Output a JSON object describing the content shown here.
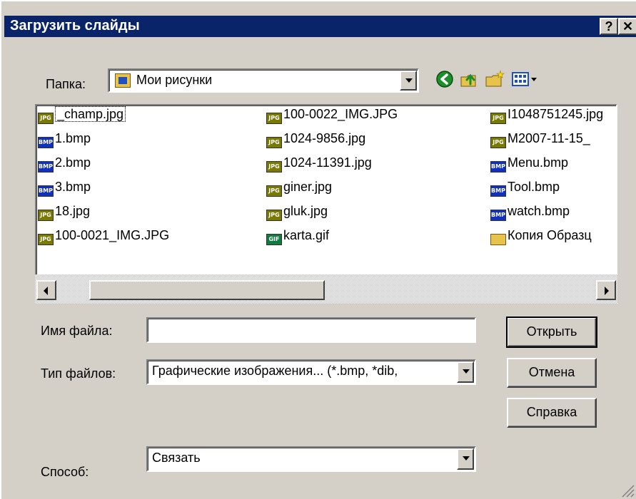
{
  "window": {
    "title": "Загрузить слайды",
    "help_label": "?",
    "close_label": "✕"
  },
  "folder": {
    "label": "Папка:",
    "value": "Мои рисунки"
  },
  "toolbar": {
    "back_icon": "back-icon",
    "up_icon": "up-folder-icon",
    "new_folder_icon": "new-folder-icon",
    "view_icon": "view-menu-icon"
  },
  "files": {
    "col1": [
      {
        "name": "_champ.jpg",
        "type": "JPG"
      },
      {
        "name": "1.bmp",
        "type": "BMP"
      },
      {
        "name": "2.bmp",
        "type": "BMP"
      },
      {
        "name": "3.bmp",
        "type": "BMP"
      },
      {
        "name": "18.jpg",
        "type": "JPG"
      },
      {
        "name": "100-0021_IMG.JPG",
        "type": "JPG"
      }
    ],
    "col2": [
      {
        "name": "100-0022_IMG.JPG",
        "type": "JPG"
      },
      {
        "name": "1024-9856.jpg",
        "type": "JPG"
      },
      {
        "name": "1024-11391.jpg",
        "type": "JPG"
      },
      {
        "name": "giner.jpg",
        "type": "JPG"
      },
      {
        "name": "gluk.jpg",
        "type": "JPG"
      },
      {
        "name": "karta.gif",
        "type": "GIF"
      }
    ],
    "col3": [
      {
        "name": "I1048751245.jpg",
        "type": "JPG"
      },
      {
        "name": "M2007-11-15_",
        "type": "JPG"
      },
      {
        "name": "Menu.bmp",
        "type": "BMP"
      },
      {
        "name": "Tool.bmp",
        "type": "BMP"
      },
      {
        "name": "watch.bmp",
        "type": "BMP"
      },
      {
        "name": "Копия Образц",
        "type": "folder"
      }
    ]
  },
  "filename": {
    "label": "Имя файла:",
    "value": ""
  },
  "filetype": {
    "label": "Тип файлов:",
    "value": "Графические изображения... (*.bmp, *dib,"
  },
  "method": {
    "label": "Способ:",
    "value": "Связать"
  },
  "buttons": {
    "open": "Открыть",
    "cancel": "Отмена",
    "help": "Справка"
  }
}
